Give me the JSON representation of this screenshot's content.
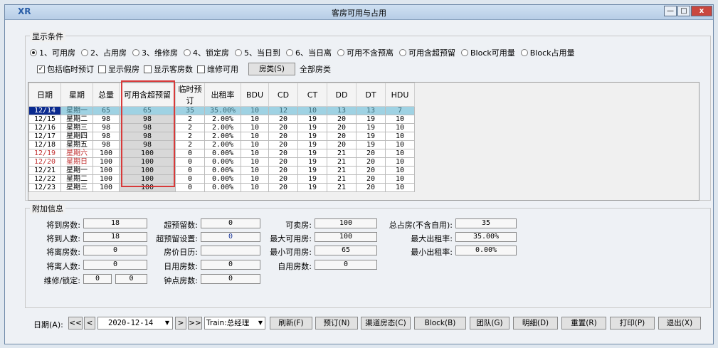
{
  "window": {
    "title": "客房可用与占用",
    "app_icon": "XR",
    "min": "—",
    "max": "□",
    "close": "x"
  },
  "display": {
    "legend": "显示条件",
    "radios": [
      {
        "label": "1、可用房",
        "checked": true
      },
      {
        "label": "2、占用房",
        "checked": false
      },
      {
        "label": "3、维修房",
        "checked": false
      },
      {
        "label": "4、锁定房",
        "checked": false
      },
      {
        "label": "5、当日到",
        "checked": false
      },
      {
        "label": "6、当日离",
        "checked": false
      },
      {
        "label": "可用不含预离",
        "checked": false
      },
      {
        "label": "可用含超预留",
        "checked": false
      },
      {
        "label": "Block可用量",
        "checked": false
      },
      {
        "label": "Block占用量",
        "checked": false
      }
    ],
    "checks": [
      {
        "label": "包括临时预订",
        "checked": true
      },
      {
        "label": "显示假房",
        "checked": false
      },
      {
        "label": "显示客房数",
        "checked": false
      },
      {
        "label": "维修可用",
        "checked": false
      }
    ],
    "room_type_button": "房类(S)",
    "room_type_value": "全部房类"
  },
  "table": {
    "headers": [
      "日期",
      "星期",
      "总量",
      "可用含超预留",
      "临时预订",
      "出租率",
      "BDU",
      "CD",
      "CT",
      "DD",
      "DT",
      "HDU"
    ],
    "rows": [
      [
        "12/14",
        "星期一",
        "65",
        "65",
        "35",
        "35.00%",
        "10",
        "12",
        "10",
        "13",
        "13",
        "7"
      ],
      [
        "12/15",
        "星期二",
        "98",
        "98",
        "2",
        "2.00%",
        "10",
        "20",
        "19",
        "20",
        "19",
        "10"
      ],
      [
        "12/16",
        "星期三",
        "98",
        "98",
        "2",
        "2.00%",
        "10",
        "20",
        "19",
        "20",
        "19",
        "10"
      ],
      [
        "12/17",
        "星期四",
        "98",
        "98",
        "2",
        "2.00%",
        "10",
        "20",
        "19",
        "20",
        "19",
        "10"
      ],
      [
        "12/18",
        "星期五",
        "98",
        "98",
        "2",
        "2.00%",
        "10",
        "20",
        "19",
        "20",
        "19",
        "10"
      ],
      [
        "12/19",
        "星期六",
        "100",
        "100",
        "0",
        "0.00%",
        "10",
        "20",
        "19",
        "21",
        "20",
        "10"
      ],
      [
        "12/20",
        "星期日",
        "100",
        "100",
        "0",
        "0.00%",
        "10",
        "20",
        "19",
        "21",
        "20",
        "10"
      ],
      [
        "12/21",
        "星期一",
        "100",
        "100",
        "0",
        "0.00%",
        "10",
        "20",
        "19",
        "21",
        "20",
        "10"
      ],
      [
        "12/22",
        "星期二",
        "100",
        "100",
        "0",
        "0.00%",
        "10",
        "20",
        "19",
        "21",
        "20",
        "10"
      ],
      [
        "12/23",
        "星期三",
        "100",
        "100",
        "0",
        "0.00%",
        "10",
        "20",
        "19",
        "21",
        "20",
        "10"
      ]
    ]
  },
  "info": {
    "legend": "附加信息",
    "fields": [
      {
        "label": "将到房数:",
        "value": "18"
      },
      {
        "label": "将到人数:",
        "value": "18"
      },
      {
        "label": "将离房数:",
        "value": "0"
      },
      {
        "label": "将离人数:",
        "value": "0"
      },
      {
        "label": "维修/锁定:",
        "value": "0"
      },
      {
        "label": "",
        "value": "0"
      },
      {
        "label": "超预留数:",
        "value": "0"
      },
      {
        "label": "超预留设置:",
        "value": "0"
      },
      {
        "label": "房价日历:",
        "value": ""
      },
      {
        "label": "日用房数:",
        "value": "0"
      },
      {
        "label": "钟点房数:",
        "value": "0"
      },
      {
        "label": "可卖房:",
        "value": "100"
      },
      {
        "label": "最大可用房:",
        "value": "100"
      },
      {
        "label": "最小可用房:",
        "value": "65"
      },
      {
        "label": "自用房数:",
        "value": "0"
      },
      {
        "label": "总占房(不含自用):",
        "value": "35"
      },
      {
        "label": "最大出租率:",
        "value": "35.00%"
      },
      {
        "label": "最小出租率:",
        "value": "0.00%"
      }
    ]
  },
  "bottom": {
    "date_label": "日期(A):",
    "first": "<<",
    "prev": "<",
    "date": "2020-12-14",
    "date_arrow": "▼",
    "next": ">",
    "last": ">>",
    "user": "Train:总经理",
    "user_arrow": "▼",
    "buttons": [
      "刷新(F)",
      "预订(N)",
      "渠道房态(C)",
      "Block(B)",
      "团队(G)",
      "明细(D)",
      "重置(R)",
      "打印(P)",
      "退出(X)"
    ]
  },
  "colors": {
    "selected_row": "#9fd2e3",
    "selected_date": "#0a2a8f",
    "weekend": "#c23232",
    "highlight_box": "#d83a3a"
  }
}
